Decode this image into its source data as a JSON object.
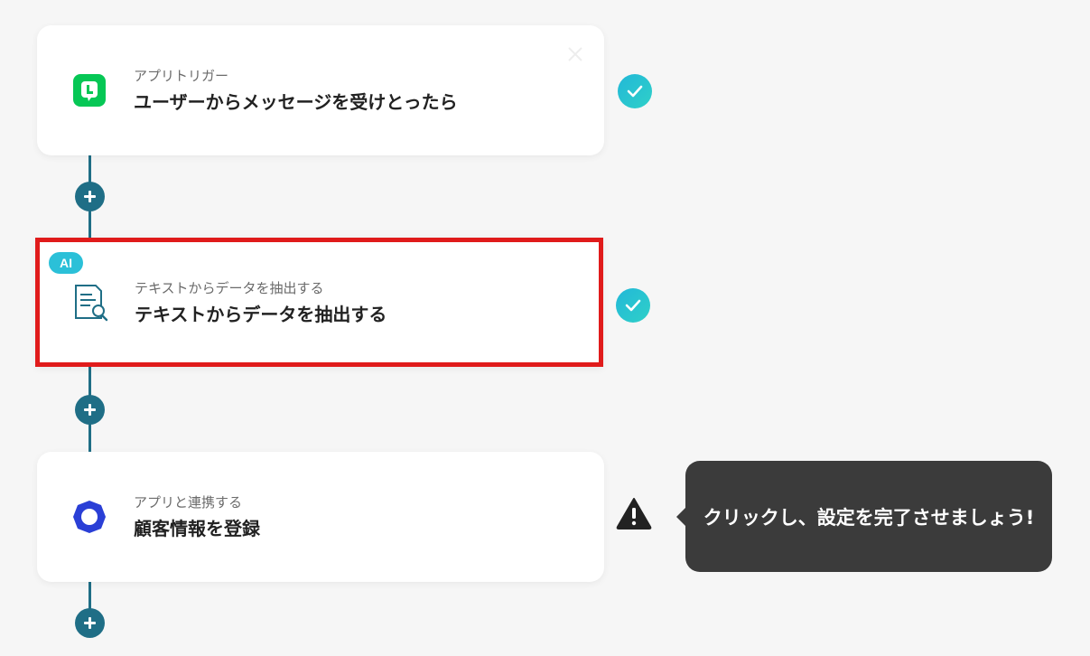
{
  "steps": [
    {
      "subtitle": "アプリトリガー",
      "title": "ユーザーからメッセージを受けとったら",
      "icon": "line-app-icon",
      "status": "complete"
    },
    {
      "badge": "AI",
      "subtitle": "テキストからデータを抽出する",
      "title": "テキストからデータを抽出する",
      "icon": "document-search-icon",
      "status": "complete",
      "highlighted": true
    },
    {
      "subtitle": "アプリと連携する",
      "title": "顧客情報を登録",
      "icon": "ring-app-icon",
      "status": "incomplete"
    }
  ],
  "tooltip": {
    "text": "クリックし、設定を完了させましょう!"
  },
  "colors": {
    "connector": "#1f6e86",
    "check": "#22b8d8",
    "highlight": "#e01b1b",
    "line_brand": "#06c755",
    "ring_brand": "#2a3fd6",
    "tooltip_bg": "#3b3b3b"
  }
}
